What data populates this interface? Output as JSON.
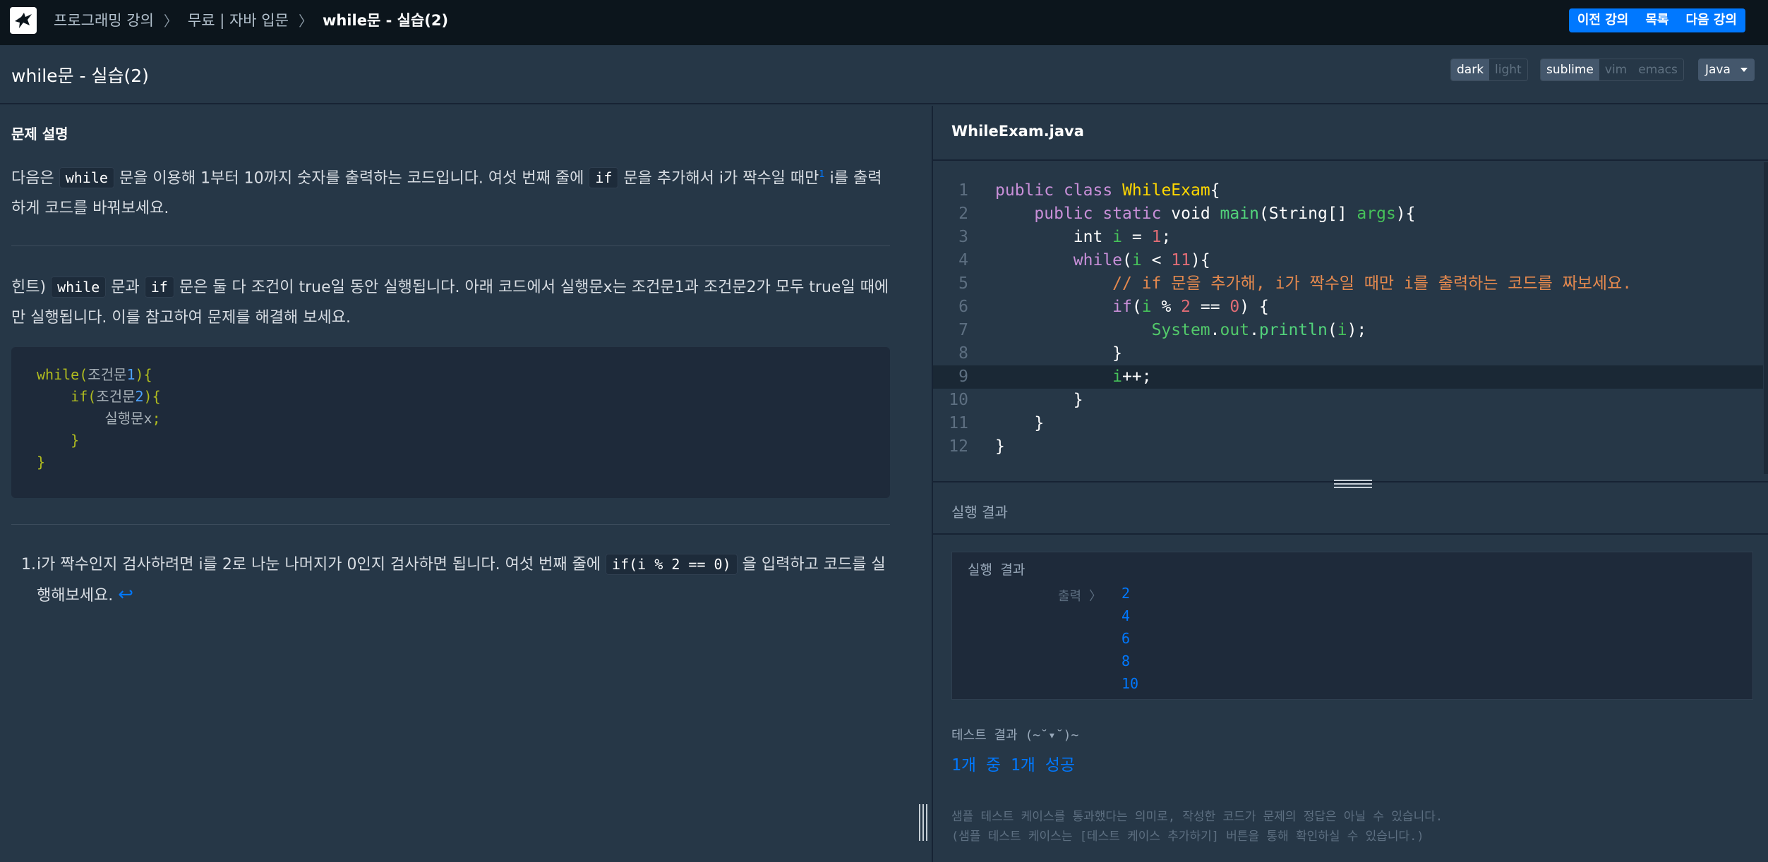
{
  "nav": {
    "breadcrumb": [
      "프로그래밍 강의",
      "무료 | 자바 입문",
      "while문 - 실습(2)"
    ],
    "prev_label": "이전 강의",
    "list_label": "목록",
    "next_label": "다음 강의",
    "logo_icon": "bird-logo-icon"
  },
  "toolbar": {
    "lesson_title": "while문 - 실습(2)",
    "themes": [
      "dark",
      "light"
    ],
    "theme_selected": "dark",
    "keymaps": [
      "sublime",
      "vim",
      "emacs"
    ],
    "keymap_selected": "sublime",
    "language": "Java"
  },
  "problem": {
    "heading": "문제 설명",
    "p1_a": "다음은 ",
    "p1_code1": "while",
    "p1_b": " 문을 이용해 1부터 10까지 숫자를 출력하는 코드입니다. 여섯 번째 줄에 ",
    "p1_code2": "if",
    "p1_c": " 문을 추가해서 i가 짝수일 때만",
    "p1_sup": "1",
    "p1_d": " i를 출력하게 코드를 바꿔보세요.",
    "hint_a": "힌트) ",
    "hint_code1": "while",
    "hint_b": " 문과 ",
    "hint_code2": "if",
    "hint_c": " 문은 둘 다 조건이 true일 동안 실행됩니다. 아래 코드에서 실행문x는 조건문1과 조건문2가 모두 true일 때에만 실행됩니다. 이를 참고하여 문제를 해결해 보세요.",
    "hint_code_lines": [
      "while(조건문1){",
      "    if(조건문2){",
      "        실행문x;",
      "    }",
      "}"
    ],
    "footnote_num": "1.",
    "footnote_a": "i가 짝수인지 검사하려면 i를 2로 나눈 나머지가 0인지 검사하면 됩니다. 여섯 번째 줄에 ",
    "footnote_code": "if(i % 2 == 0)",
    "footnote_b": " 을 입력하고 코드를 실행해보세요. ",
    "footnote_backref": "↩"
  },
  "editor": {
    "file_name": "WhileExam.java",
    "line_numbers": [
      "1",
      "2",
      "3",
      "4",
      "5",
      "6",
      "7",
      "8",
      "9",
      "10",
      "11",
      "12"
    ],
    "active_line": 9
  },
  "result": {
    "title": "실행 결과",
    "box_title": "실행 결과",
    "output_label": "출력 〉",
    "outputs": [
      "2",
      "4",
      "6",
      "8",
      "10"
    ],
    "test_label": "테스트 결과 (~˘▾˘)~",
    "test_summary": "1개 중 1개 성공",
    "note1": "샘플 테스트 케이스를 통과했다는 의미로, 작성한 코드가 문제의 정답은 아닐 수 있습니다.",
    "note2": "(샘플 테스트 케이스는 [테스트 케이스 추가하기] 버튼을 통해 확인하실 수 있습니다.)"
  },
  "colors": {
    "accent": "#0078ff",
    "background": "#263747",
    "topbar": "#0c151c"
  }
}
